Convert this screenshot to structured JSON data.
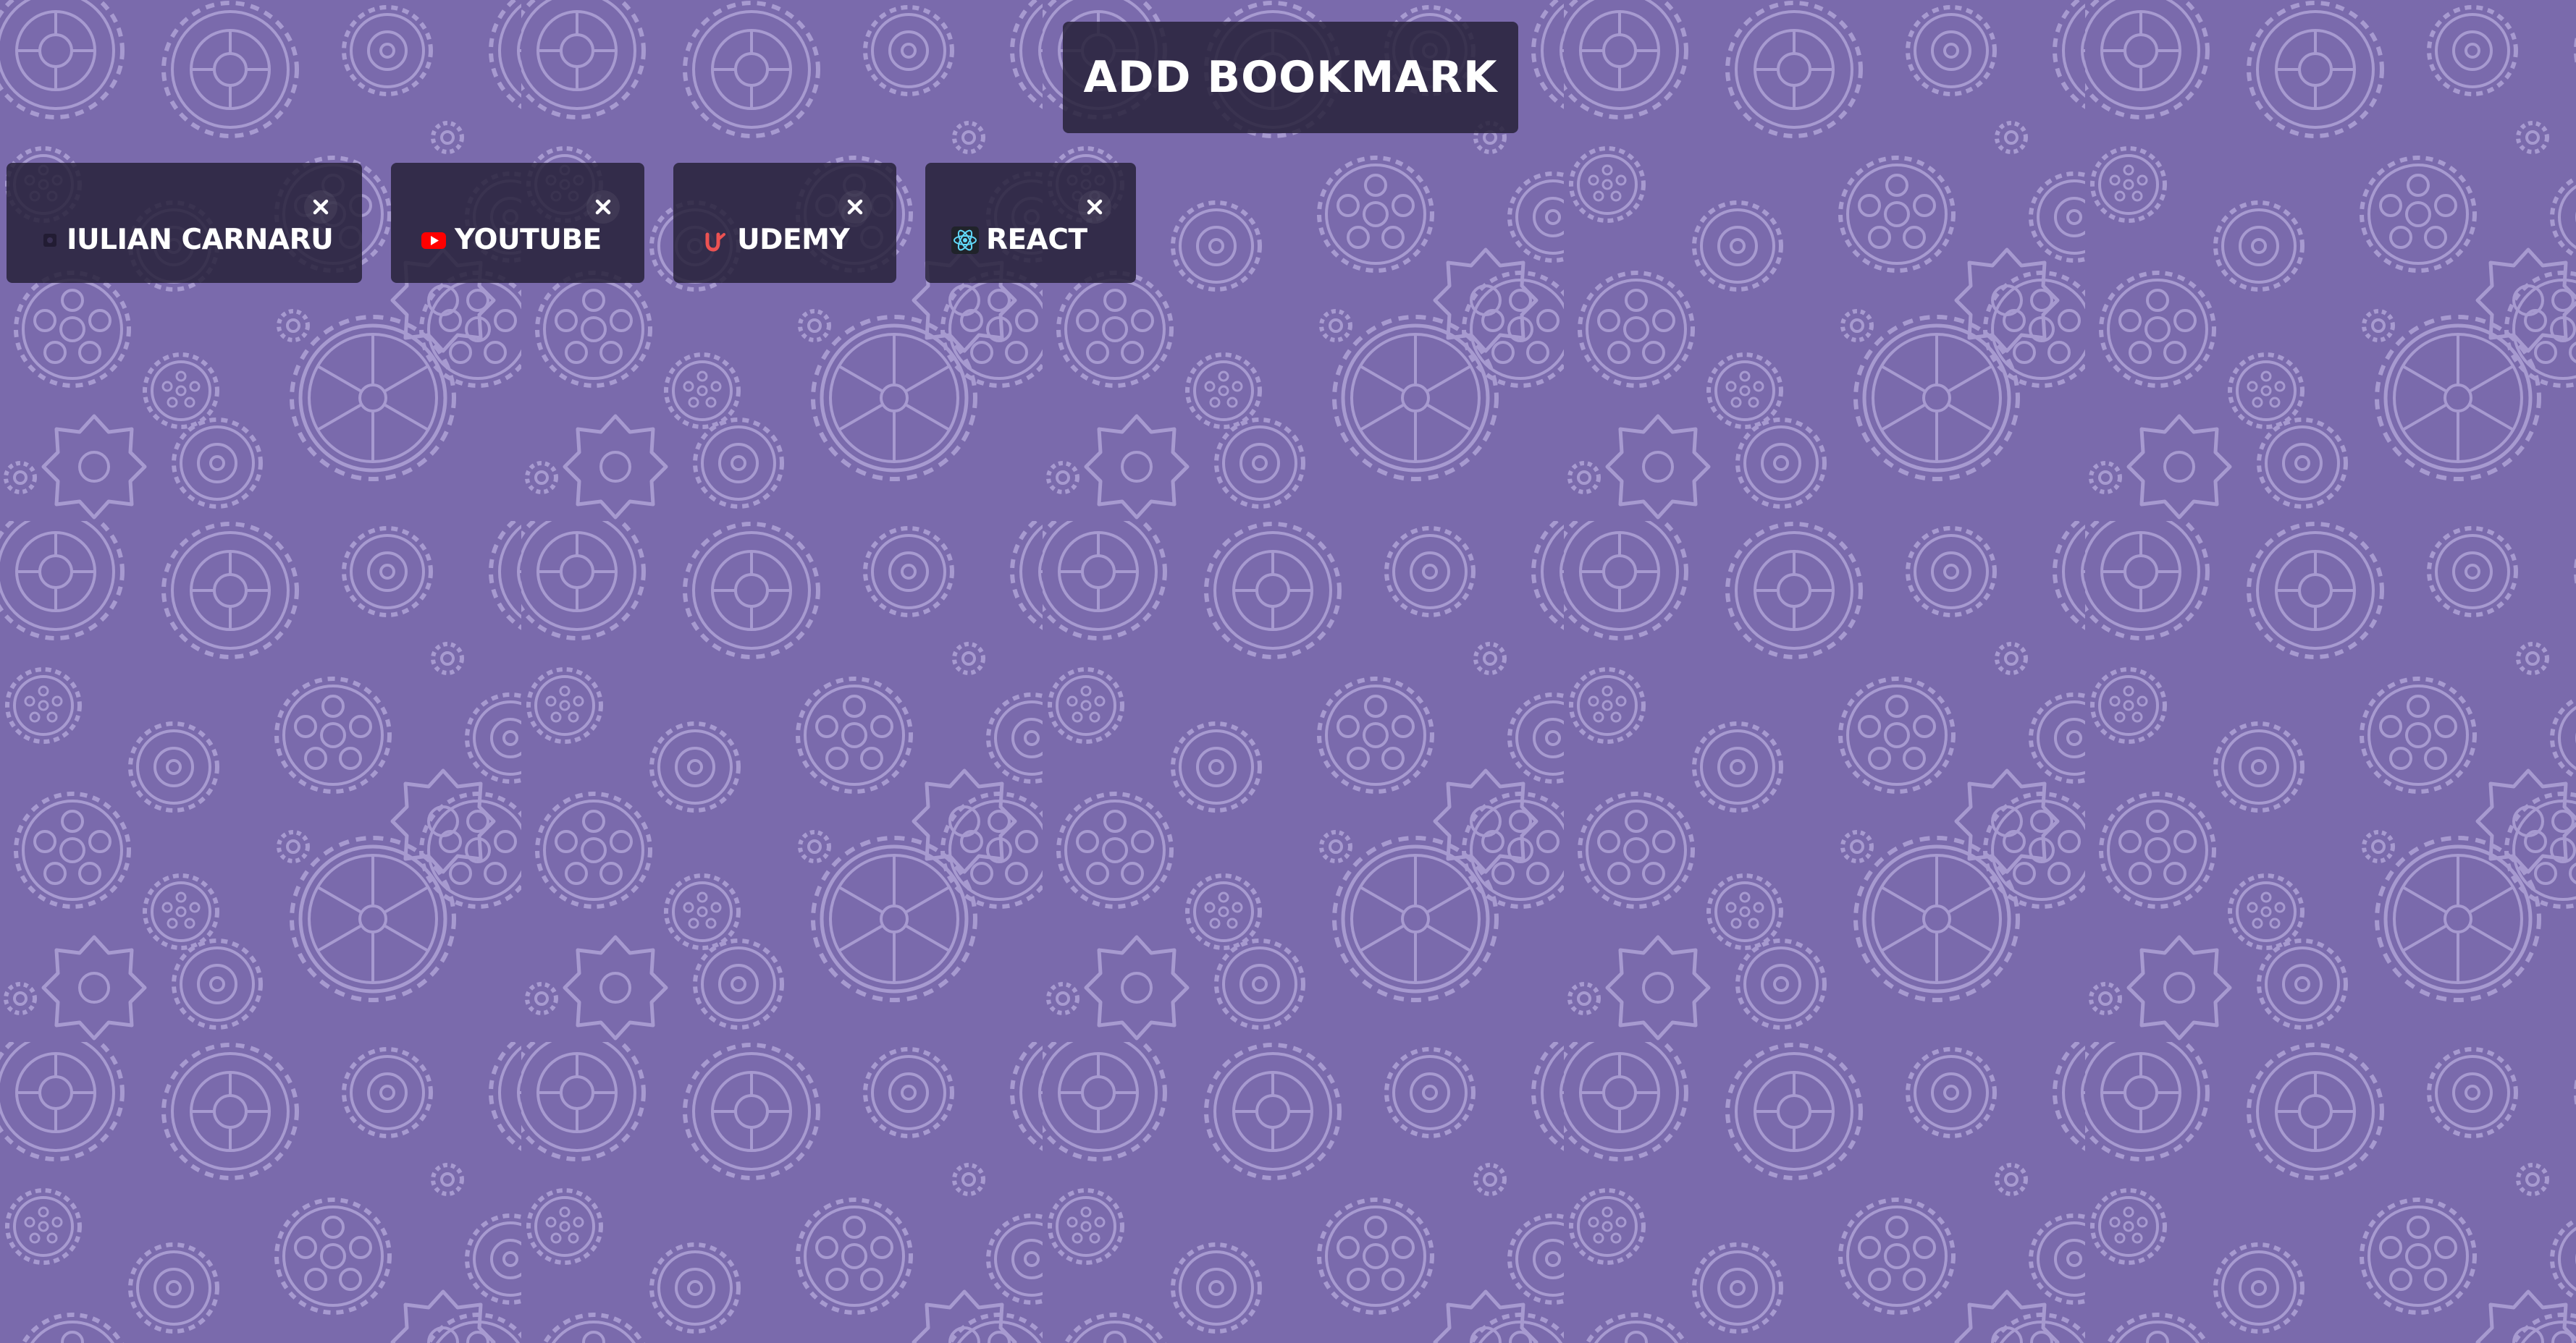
{
  "header": {
    "add_bookmark_label": "ADD BOOKMARK"
  },
  "bookmarks": [
    {
      "label": "IULIAN CARNARU",
      "icon": "site-favicon-icon"
    },
    {
      "label": "YOUTUBE",
      "icon": "youtube-icon"
    },
    {
      "label": "UDEMY",
      "icon": "udemy-icon"
    },
    {
      "label": "REACT",
      "icon": "react-icon"
    }
  ],
  "colors": {
    "background": "#7a6aac",
    "pattern": "#a79ad0",
    "card": "#28223a",
    "text": "#ffffff",
    "youtube_red": "#ff0000",
    "udemy_red": "#ec5252",
    "react_cyan": "#61dafb"
  }
}
